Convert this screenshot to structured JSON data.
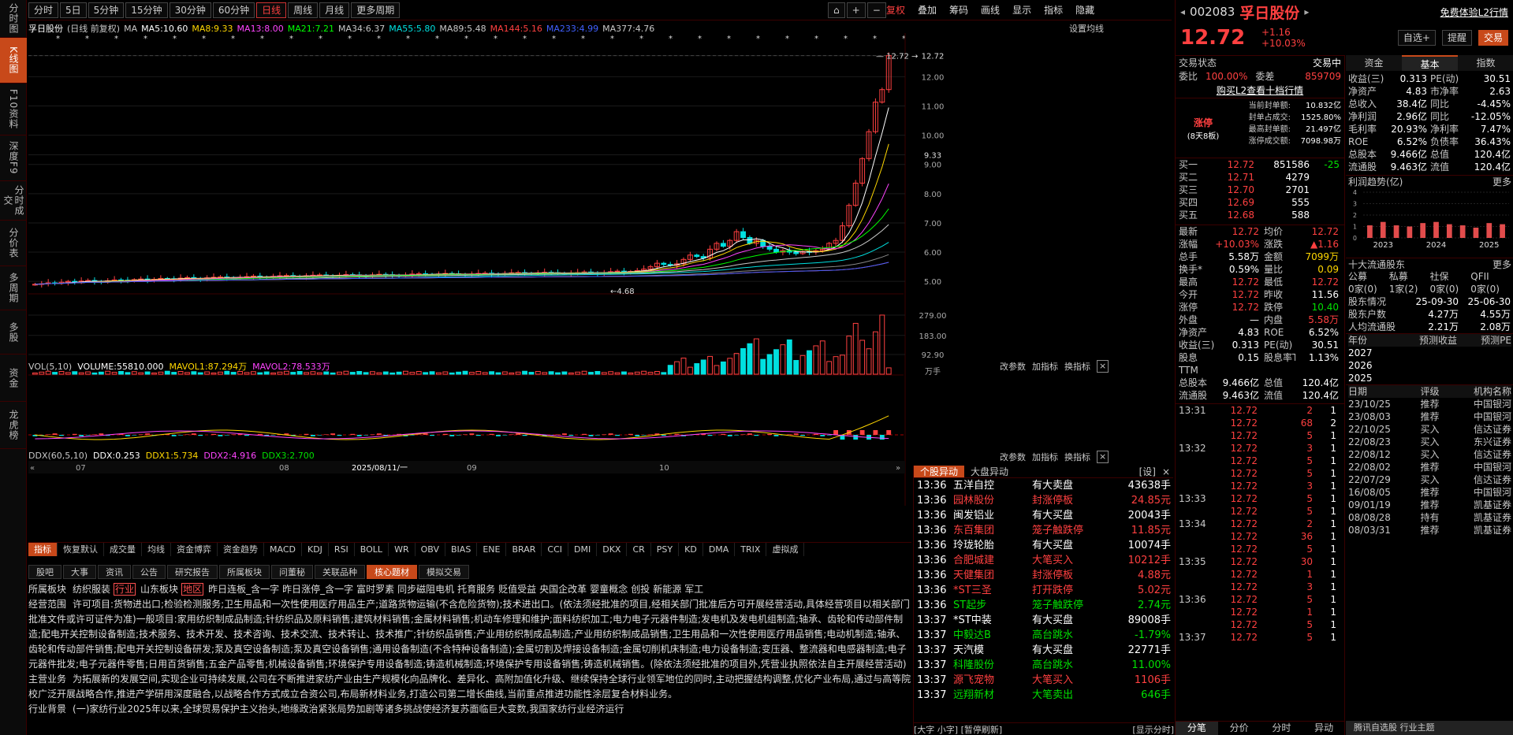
{
  "left_tabs": [
    "分时图",
    "K线图",
    "F10资料",
    "深度F9",
    "分时成交",
    "分价表",
    "多周期",
    "多股",
    "资金",
    "龙虎榜"
  ],
  "toolbar": {
    "periods": [
      "分时",
      "5日",
      "5分钟",
      "15分钟",
      "30分钟",
      "60分钟",
      "日线",
      "周线",
      "月线",
      "更多周期"
    ],
    "active": "日线",
    "right": [
      "复权",
      "叠加",
      "筹码",
      "画线",
      "显示",
      "指标",
      "隐藏"
    ]
  },
  "ma_header": {
    "name": "孚日股份",
    "mode": "(日线 前复权)",
    "items": [
      {
        "t": "MA",
        "c": "#c8c8c8"
      },
      {
        "t": "MA5:10.60",
        "c": "#ffffff"
      },
      {
        "t": "MA8:9.33",
        "c": "#ffd700"
      },
      {
        "t": "MA13:8.00",
        "c": "#ff44ff"
      },
      {
        "t": "MA21:7.21",
        "c": "#00ff00"
      },
      {
        "t": "MA34:6.37",
        "c": "#c8c8c8"
      },
      {
        "t": "MA55:5.80",
        "c": "#00e0e0"
      },
      {
        "t": "MA89:5.48",
        "c": "#c8c8c8"
      },
      {
        "t": "MA144:5.16",
        "c": "#ff4040"
      },
      {
        "t": "MA233:4.99",
        "c": "#4060ff"
      },
      {
        "t": "MA377:4.76",
        "c": "#c8c8c8"
      }
    ],
    "settings": "设置均线"
  },
  "price_axis": [
    "12.72",
    "12.00",
    "11.00",
    "10.00",
    "9.33",
    "9.00",
    "8.00",
    "7.00",
    "6.00",
    "5.00"
  ],
  "annotations": {
    "high": "12.72",
    "low": "4.68"
  },
  "vol_header": {
    "label": "VOL(5,10)",
    "volume": "VOLUME:55810.000",
    "mavol1": "MAVOL1:87.294万",
    "mavol2": "MAVOL2:78.533万",
    "buttons": [
      "改参数",
      "加指标",
      "换指标"
    ]
  },
  "vol_axis": [
    "279.00",
    "183.00",
    "92.90",
    "万手"
  ],
  "ddx_header": {
    "label": "DDX(60,5,10)",
    "ddx": "DDX:0.253",
    "ddx1": "DDX1:5.734",
    "ddx2": "DDX2:4.916",
    "ddx3": "DDX3:2.700",
    "buttons": [
      "改参数",
      "加指标",
      "换指标"
    ]
  },
  "x_axis": [
    "07",
    "08",
    "2025/08/11/一",
    "09",
    "10"
  ],
  "indicator_tabs": [
    "指标",
    "恢复默认",
    "成交量",
    "均线",
    "资金博弈",
    "资金趋势",
    "MACD",
    "KDJ",
    "RSI",
    "BOLL",
    "WR",
    "OBV",
    "BIAS",
    "ENE",
    "BRAR",
    "CCI",
    "DMI",
    "DKX",
    "CR",
    "PSY",
    "KD",
    "DMA",
    "TRIX",
    "虚拟成"
  ],
  "f10_tabs": [
    "股吧",
    "大事",
    "资讯",
    "公告",
    "研究报告",
    "所属板块",
    "问董秘",
    "关联品种",
    "核心题材",
    "模拟交易"
  ],
  "f10_active": "核心题材",
  "f10": {
    "sector_label": "所属板块",
    "sectors": [
      "纺织服装",
      "行业",
      "山东板块",
      "地区",
      "昨日连板_含一字",
      "昨日涨停_含一字",
      "富时罗素",
      "同步磁阻电机",
      "托育服务",
      "贬值受益",
      "央国企改革",
      "婴童概念",
      "创投",
      "新能源",
      "军工"
    ],
    "scope_label": "经营范围",
    "scope": "许可项目:货物进出口;检验检测服务;卫生用品和一次性使用医疗用品生产;道路货物运输(不含危险货物);技术进出口。(依法须经批准的项目,经相关部门批准后方可开展经营活动,具体经营项目以相关部门批准文件或许可证件为准)一般项目:家用纺织制成品制造;针纺织品及原料销售;建筑材料销售;金属材料销售;机动车修理和维护;面料纺织加工;电力电子元器件制造;发电机及发电机组制造;轴承、齿轮和传动部件制造;配电开关控制设备制造;技术服务、技术开发、技术咨询、技术交流、技术转让、技术推广;针纺织品销售;产业用纺织制成品制造;产业用纺织制成品销售;卫生用品和一次性使用医疗用品销售;电动机制造;轴承、齿轮和传动部件销售;配电开关控制设备研发;泵及真空设备制造;泵及真空设备销售;通用设备制造(不含特种设备制造);金属切割及焊接设备制造;金属切削机床制造;电力设备制造;变压器、整流器和电感器制造;电子元器件批发;电子元器件零售;日用百货销售;五金产品零售;机械设备销售;环境保护专用设备制造;铸造机械制造;环境保护专用设备销售;铸造机械销售。(除依法须经批准的项目外,凭营业执照依法自主开展经营活动)",
    "main_label": "主营业务",
    "main": "为拓展新的发展空间,实现企业可持续发展,公司在不断推进家纺产业由生产规模化向品牌化、差异化、高附加值化升级、继续保持全球行业领军地位的同时,主动把握结构调整,优化产业布局,通过与高等院校广泛开展战略合作,推进产学研用深度融合,以战略合作方式成立合资公司,布局新材料业务,打造公司第二增长曲线,当前重点推进功能性涂层复合材料业务。",
    "bg_label": "行业背景",
    "bg": "(一)家纺行业2025年以来,全球贸易保护主义抬头,地缘政治紧张局势加剧等诸多挑战使经济复苏面临巨大变数,我国家纺行业经济运行"
  },
  "yidong": {
    "tabs": [
      "个股异动",
      "大盘异动",
      "[设]"
    ],
    "rows": [
      {
        "time": "13:36",
        "name": "五洋自控",
        "type": "有大卖盘",
        "val": "43638手",
        "c": "w"
      },
      {
        "time": "13:36",
        "name": "园林股份",
        "type": "封涨停板",
        "val": "24.85元",
        "c": "r"
      },
      {
        "time": "13:36",
        "name": "闽发铝业",
        "type": "有大买盘",
        "val": "20043手",
        "c": "w"
      },
      {
        "time": "13:36",
        "name": "东百集团",
        "type": "笼子触跌停",
        "val": "11.85元",
        "c": "r"
      },
      {
        "time": "13:36",
        "name": "玲珑轮胎",
        "type": "有大买盘",
        "val": "10074手",
        "c": "w"
      },
      {
        "time": "13:36",
        "name": "合肥城建",
        "type": "大笔买入",
        "val": "10212手",
        "c": "r"
      },
      {
        "time": "13:36",
        "name": "天健集团",
        "type": "封涨停板",
        "val": "4.88元",
        "c": "r"
      },
      {
        "time": "13:36",
        "name": "*ST三圣",
        "type": "打开跌停",
        "val": "5.02元",
        "c": "r"
      },
      {
        "time": "13:36",
        "name": "ST起步",
        "type": "笼子触跌停",
        "val": "2.74元",
        "c": "g"
      },
      {
        "time": "13:37",
        "name": "*ST中装",
        "type": "有大买盘",
        "val": "89008手",
        "c": "w"
      },
      {
        "time": "13:37",
        "name": "中毅达B",
        "type": "高台跳水",
        "val": "-1.79%",
        "c": "g"
      },
      {
        "time": "13:37",
        "name": "天汽模",
        "type": "有大买盘",
        "val": "22771手",
        "c": "w"
      },
      {
        "time": "13:37",
        "name": "科隆股份",
        "type": "高台跳水",
        "val": "11.00%",
        "c": "g"
      },
      {
        "time": "13:37",
        "name": "源飞宠物",
        "type": "大笔买入",
        "val": "1106手",
        "c": "r"
      },
      {
        "time": "13:37",
        "name": "远翔新材",
        "type": "大笔卖出",
        "val": "646手",
        "c": "g"
      }
    ],
    "footer": "[大字 小字] [暂停刷新]",
    "footer_right": "[显示分时]"
  },
  "stock": {
    "code": "002083",
    "name": "孚日股份",
    "price": "12.72",
    "change": "+1.16",
    "pct": "+10.03%",
    "trial": "免费体验L2行情",
    "btn_watch": "自选+",
    "btn_alert": "提醒",
    "btn_trade": "交易"
  },
  "trade_status": {
    "label": "交易状态",
    "value": "交易中",
    "wb_label": "委比",
    "wb": "100.00%",
    "wc_label": "委差",
    "wc": "859709",
    "buy_l2": "购买L2查看十档行情"
  },
  "limit": {
    "title": "涨停",
    "sub": "(8天8板)",
    "rows": [
      [
        "当前封单额:",
        "10.832亿"
      ],
      [
        "封单占成交:",
        "1525.80%"
      ],
      [
        "最高封单额:",
        "21.497亿"
      ],
      [
        "涨停成交额:",
        "7098.98万"
      ]
    ]
  },
  "book": [
    [
      "买一",
      "12.72",
      "851586",
      "-25"
    ],
    [
      "买二",
      "12.71",
      "4279",
      ""
    ],
    [
      "买三",
      "12.70",
      "2701",
      ""
    ],
    [
      "买四",
      "12.69",
      "555",
      ""
    ],
    [
      "买五",
      "12.68",
      "588",
      ""
    ]
  ],
  "quote": [
    [
      "最新",
      "12.72",
      "r",
      "均价",
      "12.72",
      "r"
    ],
    [
      "涨幅",
      "+10.03%",
      "r",
      "涨跌",
      "▲1.16",
      "r"
    ],
    [
      "总手",
      "5.58万",
      "w",
      "金额",
      "7099万",
      "y"
    ],
    [
      "换手*",
      "0.59%",
      "w",
      "量比",
      "0.09",
      "y"
    ],
    [
      "最高",
      "12.72",
      "r",
      "最低",
      "12.72",
      "r"
    ],
    [
      "今开",
      "12.72",
      "r",
      "昨收",
      "11.56",
      "w"
    ],
    [
      "涨停",
      "12.72",
      "r",
      "跌停",
      "10.40",
      "g"
    ],
    [
      "外盘",
      "—",
      "w",
      "内盘",
      "5.58万",
      "r"
    ],
    [
      "净资产",
      "4.83",
      "w",
      "ROE",
      "6.52%",
      "w"
    ],
    [
      "收益(三)",
      "0.313",
      "w",
      "PE(动)",
      "30.51",
      "w"
    ],
    [
      "股息TTM",
      "0.15",
      "w",
      "股息率TTM",
      "1.13%",
      "w"
    ],
    [
      "总股本",
      "9.466亿",
      "w",
      "总值",
      "120.4亿",
      "w"
    ],
    [
      "流通股",
      "9.463亿",
      "w",
      "流值",
      "120.4亿",
      "w"
    ]
  ],
  "ticks": [
    [
      "13:31",
      "12.72",
      "2",
      "1"
    ],
    [
      "",
      "12.72",
      "68",
      "2"
    ],
    [
      "",
      "12.72",
      "5",
      "1"
    ],
    [
      "13:32",
      "12.72",
      "3",
      "1"
    ],
    [
      "",
      "12.72",
      "5",
      "1"
    ],
    [
      "",
      "12.72",
      "5",
      "1"
    ],
    [
      "",
      "12.72",
      "3",
      "1"
    ],
    [
      "13:33",
      "12.72",
      "5",
      "1"
    ],
    [
      "",
      "12.72",
      "5",
      "1"
    ],
    [
      "13:34",
      "12.72",
      "2",
      "1"
    ],
    [
      "",
      "12.72",
      "36",
      "1"
    ],
    [
      "",
      "12.72",
      "5",
      "1"
    ],
    [
      "13:35",
      "12.72",
      "30",
      "1"
    ],
    [
      "",
      "12.72",
      "1",
      "1"
    ],
    [
      "",
      "12.72",
      "3",
      "1"
    ],
    [
      "13:36",
      "12.72",
      "5",
      "1"
    ],
    [
      "",
      "12.72",
      "1",
      "1"
    ],
    [
      "",
      "12.72",
      "5",
      "1"
    ],
    [
      "13:37",
      "12.72",
      "5",
      "1"
    ]
  ],
  "bottom_tabs": [
    "分笔",
    "分价",
    "分时",
    "异动"
  ],
  "bottom_bar": "腾讯自选股 行业主题",
  "f9_tabs": [
    "资金",
    "基本",
    "指数"
  ],
  "f9_active": "基本",
  "fund": [
    [
      "收益(三)",
      "0.313",
      "PE(动)",
      "30.51"
    ],
    [
      "净资产",
      "4.83",
      "市净率",
      "2.63"
    ],
    [
      "总收入",
      "38.4亿",
      "同比",
      "-4.45%"
    ],
    [
      "净利润",
      "2.96亿",
      "同比",
      "-12.05%"
    ],
    [
      "毛利率",
      "20.93%",
      "净利率",
      "7.47%"
    ],
    [
      "ROE",
      "6.52%",
      "负债率",
      "36.43%"
    ],
    [
      "总股本",
      "9.466亿",
      "总值",
      "120.4亿"
    ],
    [
      "流通股",
      "9.463亿",
      "流值",
      "120.4亿"
    ]
  ],
  "profit": {
    "title": "利润趋势(亿)",
    "more": "更多",
    "yticks": [
      "4",
      "3",
      "2",
      "1",
      "0"
    ],
    "years": [
      "2023",
      "2024",
      "2025"
    ],
    "values": [
      1.1,
      1.4,
      1.1,
      1.0,
      1.3,
      1.4,
      1.2,
      1.1,
      0.9,
      1.3,
      1.2
    ]
  },
  "holders": {
    "title": "十大流通股东",
    "more": "更多",
    "cats": [
      "公募",
      "私募",
      "社保",
      "QFII"
    ],
    "vals": [
      "0家(0)",
      "1家(2)",
      "0家(0)",
      "0家(0)"
    ],
    "rows": [
      [
        "股东情况",
        "25-09-30",
        "25-06-30"
      ],
      [
        "股东户数",
        "4.27万",
        "4.55万"
      ],
      [
        "人均流通股",
        "2.21万",
        "2.08万"
      ]
    ]
  },
  "forecast": {
    "h": [
      "年份",
      "预测收益",
      "预测PE"
    ],
    "years": [
      "2027",
      "2026",
      "2025"
    ]
  },
  "rating": {
    "h": [
      "日期",
      "评级",
      "机构名称"
    ],
    "rows": [
      [
        "23/10/25",
        "推荐",
        "中国银河"
      ],
      [
        "23/08/03",
        "推荐",
        "中国银河"
      ],
      [
        "22/10/25",
        "买入",
        "信达证券"
      ],
      [
        "22/08/23",
        "买入",
        "东兴证券"
      ],
      [
        "22/08/12",
        "买入",
        "信达证券"
      ],
      [
        "22/08/02",
        "推荐",
        "中国银河"
      ],
      [
        "22/07/29",
        "买入",
        "信达证券"
      ],
      [
        "16/08/05",
        "推荐",
        "中国银河"
      ],
      [
        "09/01/19",
        "推荐",
        "凯基证券"
      ],
      [
        "08/08/28",
        "持有",
        "凯基证券"
      ],
      [
        "08/03/31",
        "推荐",
        "凯基证券"
      ]
    ]
  },
  "chart_data": {
    "type": "candlestick",
    "note_series": "daily closes, front-adjusted",
    "closes": [
      4.9,
      4.92,
      4.95,
      4.93,
      4.97,
      5.0,
      4.98,
      5.01,
      5.03,
      5.0,
      4.99,
      5.02,
      5.05,
      5.04,
      5.03,
      5.06,
      5.08,
      5.05,
      5.07,
      5.1,
      5.09,
      5.08,
      5.11,
      5.13,
      5.1,
      5.09,
      5.12,
      5.14,
      5.15,
      5.13,
      5.12,
      5.14,
      5.16,
      5.18,
      5.15,
      5.14,
      5.17,
      5.19,
      5.2,
      5.18,
      5.16,
      5.19,
      5.21,
      5.22,
      5.2,
      5.19,
      5.21,
      5.23,
      5.22,
      5.2,
      5.19,
      5.22,
      5.24,
      5.23,
      5.21,
      5.2,
      5.22,
      5.25,
      5.26,
      5.24,
      5.23,
      5.25,
      5.27,
      5.26,
      5.24,
      5.23,
      5.25,
      5.27,
      5.28,
      5.26,
      5.25,
      5.27,
      5.29,
      5.3,
      5.28,
      5.27,
      5.29,
      5.31,
      5.3,
      5.28,
      5.27,
      5.29,
      5.3,
      5.32,
      5.3,
      5.28,
      5.3,
      5.33,
      5.35,
      5.32,
      5.34,
      5.37,
      5.42,
      5.5,
      5.62,
      5.58,
      5.55,
      5.6,
      5.75,
      5.9,
      5.85,
      5.8,
      6.1,
      6.3,
      6.2,
      6.4,
      6.7,
      6.5,
      6.3,
      6.4,
      6.2,
      6.1,
      6.0,
      6.05,
      6.0,
      5.95,
      6.02,
      6.0,
      6.05,
      6.1,
      6.3,
      6.4,
      6.9,
      7.6,
      8.36,
      9.2,
      10.12,
      11.13,
      11.56,
      12.72
    ],
    "ylim": [
      4.6,
      12.9
    ],
    "ma_values": {
      "MA5": 10.6,
      "MA8": 9.33,
      "MA13": 8.0,
      "MA21": 7.21,
      "MA34": 6.37,
      "MA55": 5.8,
      "MA89": 5.48,
      "MA144": 5.16,
      "MA233": 4.99,
      "MA377": 4.76
    }
  }
}
